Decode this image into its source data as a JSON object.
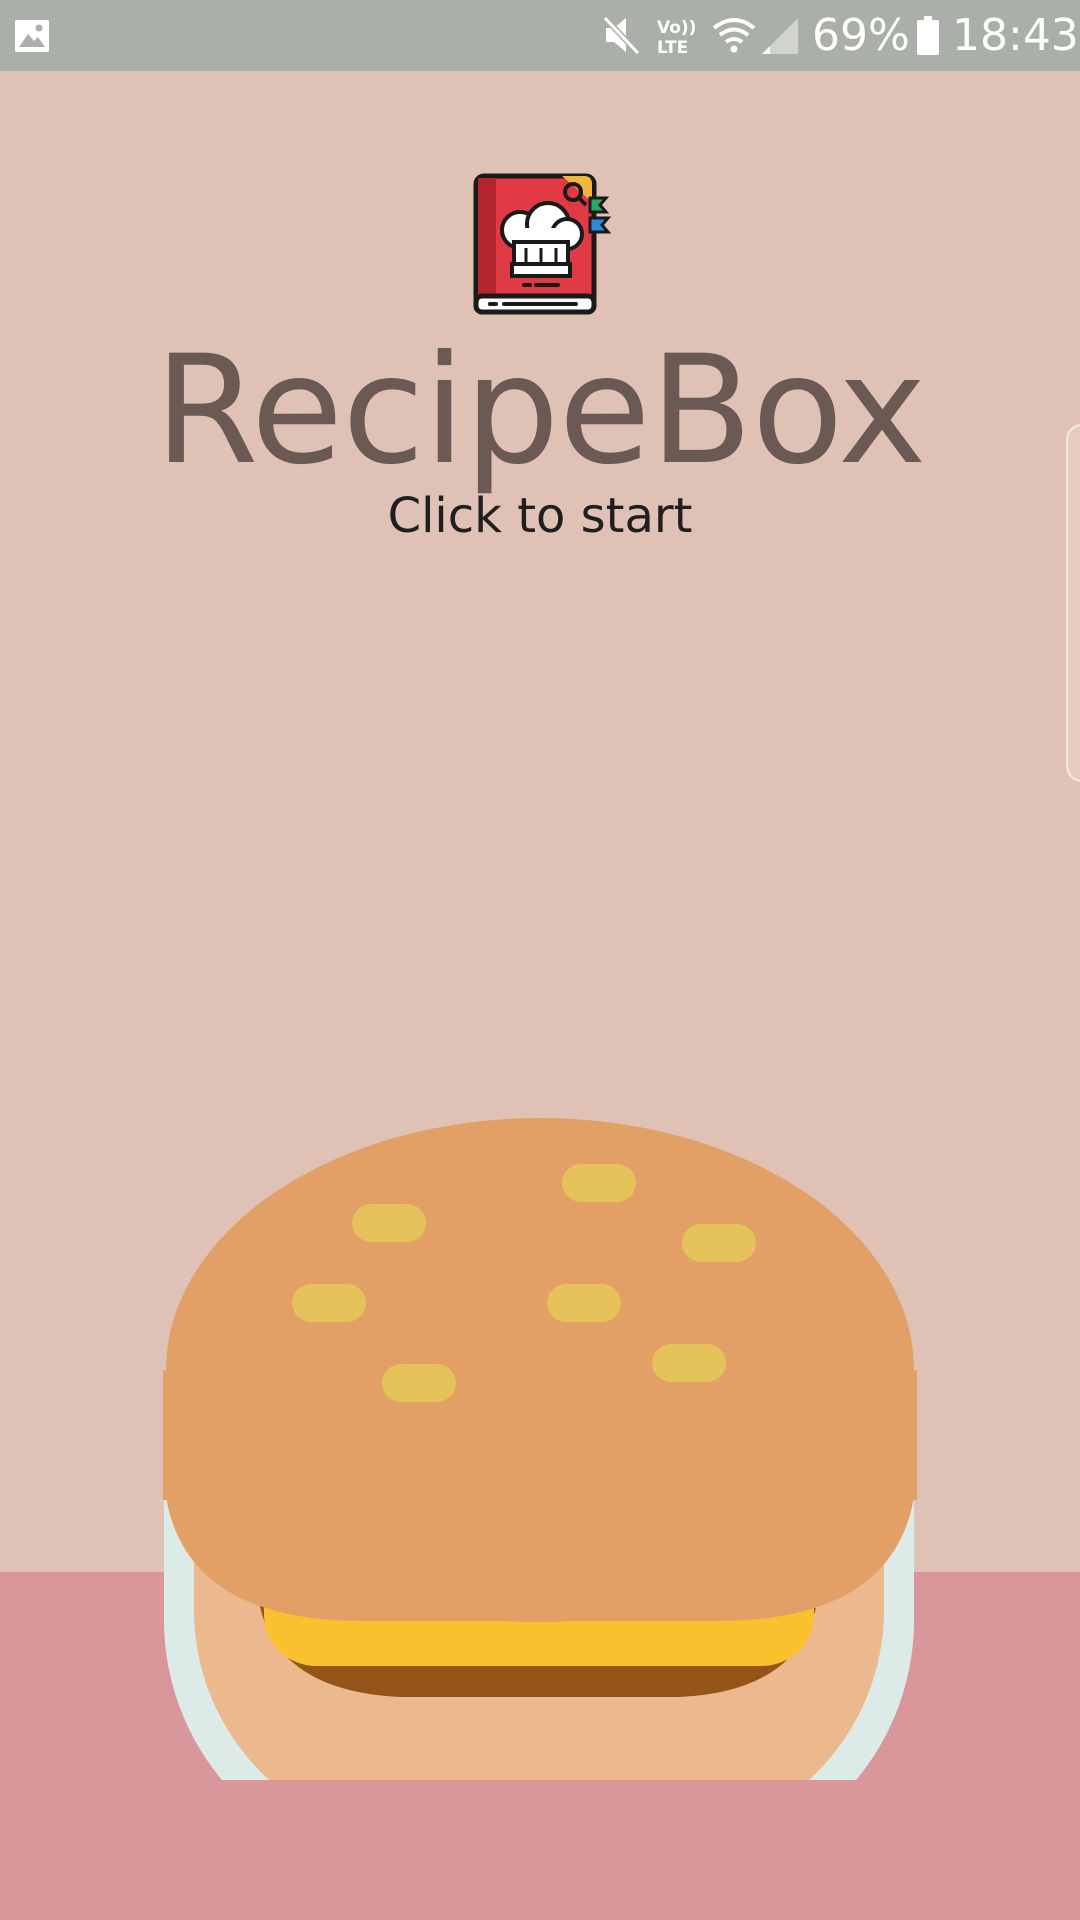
{
  "status_bar": {
    "battery_percent": "69%",
    "time": "18:43",
    "icons": [
      "gallery-icon",
      "mute-icon",
      "volte-icon",
      "wifi-icon",
      "signal-icon",
      "battery-icon"
    ]
  },
  "app": {
    "logo_icon": "recipe-book-chef-hat-icon",
    "title": "RecipeBox",
    "subtitle": "Click to start"
  },
  "illustration": {
    "name": "hamburger-illustration",
    "colors": {
      "background": "#e0c1b5",
      "floor": "#d9979b",
      "bun": "#e3a066",
      "sesame": "#e5c25a",
      "cheese": "#fbc02d",
      "patty": "#955519",
      "plate": "#ddebe8"
    }
  }
}
